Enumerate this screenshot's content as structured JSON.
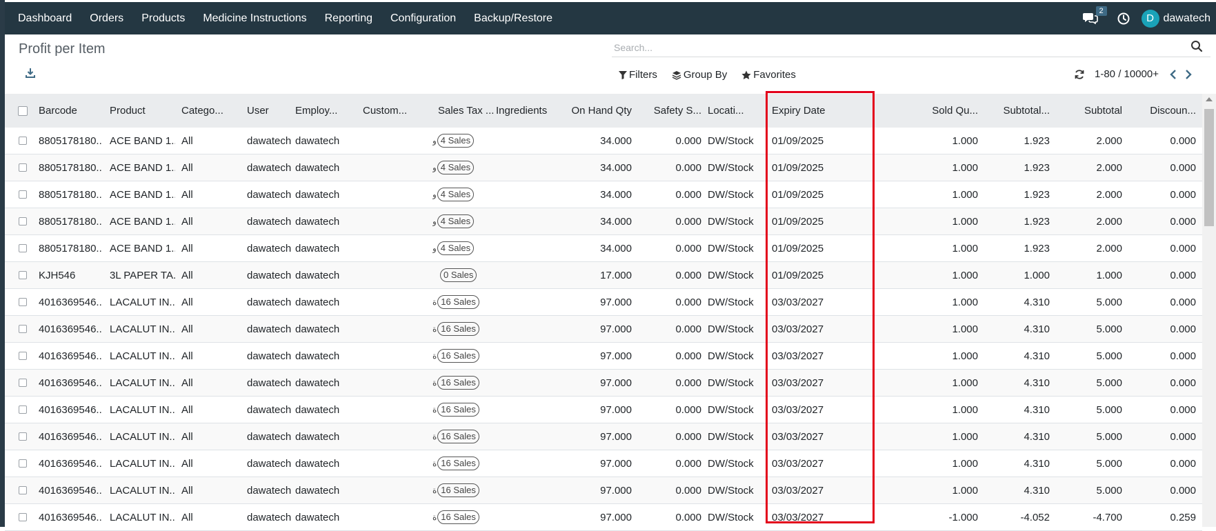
{
  "nav": {
    "items": [
      "Dashboard",
      "Orders",
      "Products",
      "Medicine Instructions",
      "Reporting",
      "Configuration",
      "Backup/Restore"
    ],
    "chat_count": "2",
    "avatar_letter": "D",
    "username": "dawatech"
  },
  "page": {
    "title": "Profit per Item",
    "search_placeholder": "Search...",
    "filters_label": "Filters",
    "groupby_label": "Group By",
    "favorites_label": "Favorites",
    "pager_value": "1-80 / 10000+"
  },
  "table": {
    "columns": [
      "Barcode",
      "Product",
      "Catego...",
      "User",
      "Employ...",
      "Custom...",
      "Sales Tax ...",
      "Ingredients",
      "On Hand Qty",
      "Safety S...",
      "Locati...",
      "Expiry Date",
      "Sold Qu...",
      "Subtotal...",
      "Subtotal",
      "Discoun..."
    ],
    "rows": [
      {
        "barcode": "8805178180...",
        "product": "ACE BAND 1...",
        "category": "All",
        "user": "dawatech",
        "employee": "dawatech",
        "customer": "",
        "tax_prefix": "و",
        "tax": "4 Sales",
        "ingredients": "",
        "onhand": "34.000",
        "safety": "0.000",
        "location": "DW/Stock",
        "expiry": "01/09/2025",
        "sold": "1.000",
        "subtotal_a": "1.923",
        "subtotal": "2.000",
        "discount": "0.000"
      },
      {
        "barcode": "8805178180...",
        "product": "ACE BAND 1...",
        "category": "All",
        "user": "dawatech",
        "employee": "dawatech",
        "customer": "",
        "tax_prefix": "و",
        "tax": "4 Sales",
        "ingredients": "",
        "onhand": "34.000",
        "safety": "0.000",
        "location": "DW/Stock",
        "expiry": "01/09/2025",
        "sold": "1.000",
        "subtotal_a": "1.923",
        "subtotal": "2.000",
        "discount": "0.000"
      },
      {
        "barcode": "8805178180...",
        "product": "ACE BAND 1...",
        "category": "All",
        "user": "dawatech",
        "employee": "dawatech",
        "customer": "",
        "tax_prefix": "و",
        "tax": "4 Sales",
        "ingredients": "",
        "onhand": "34.000",
        "safety": "0.000",
        "location": "DW/Stock",
        "expiry": "01/09/2025",
        "sold": "1.000",
        "subtotal_a": "1.923",
        "subtotal": "2.000",
        "discount": "0.000"
      },
      {
        "barcode": "8805178180...",
        "product": "ACE BAND 1...",
        "category": "All",
        "user": "dawatech",
        "employee": "dawatech",
        "customer": "",
        "tax_prefix": "و",
        "tax": "4 Sales",
        "ingredients": "",
        "onhand": "34.000",
        "safety": "0.000",
        "location": "DW/Stock",
        "expiry": "01/09/2025",
        "sold": "1.000",
        "subtotal_a": "1.923",
        "subtotal": "2.000",
        "discount": "0.000"
      },
      {
        "barcode": "8805178180...",
        "product": "ACE BAND 1...",
        "category": "All",
        "user": "dawatech",
        "employee": "dawatech",
        "customer": "",
        "tax_prefix": "و",
        "tax": "4 Sales",
        "ingredients": "",
        "onhand": "34.000",
        "safety": "0.000",
        "location": "DW/Stock",
        "expiry": "01/09/2025",
        "sold": "1.000",
        "subtotal_a": "1.923",
        "subtotal": "2.000",
        "discount": "0.000"
      },
      {
        "barcode": "KJH546",
        "product": "3L PAPER TA...",
        "category": "All",
        "user": "dawatech",
        "employee": "dawatech",
        "customer": "",
        "tax_prefix": "",
        "tax": "0 Sales",
        "ingredients": "",
        "onhand": "17.000",
        "safety": "0.000",
        "location": "DW/Stock",
        "expiry": "01/09/2025",
        "sold": "1.000",
        "subtotal_a": "1.000",
        "subtotal": "1.000",
        "discount": "0.000"
      },
      {
        "barcode": "4016369546...",
        "product": "LACALUT IN...",
        "category": "All",
        "user": "dawatech",
        "employee": "dawatech",
        "customer": "",
        "tax_prefix": "ة",
        "tax": "16 Sales",
        "ingredients": "",
        "onhand": "97.000",
        "safety": "0.000",
        "location": "DW/Stock",
        "expiry": "03/03/2027",
        "sold": "1.000",
        "subtotal_a": "4.310",
        "subtotal": "5.000",
        "discount": "0.000"
      },
      {
        "barcode": "4016369546...",
        "product": "LACALUT IN...",
        "category": "All",
        "user": "dawatech",
        "employee": "dawatech",
        "customer": "",
        "tax_prefix": "ة",
        "tax": "16 Sales",
        "ingredients": "",
        "onhand": "97.000",
        "safety": "0.000",
        "location": "DW/Stock",
        "expiry": "03/03/2027",
        "sold": "1.000",
        "subtotal_a": "4.310",
        "subtotal": "5.000",
        "discount": "0.000"
      },
      {
        "barcode": "4016369546...",
        "product": "LACALUT IN...",
        "category": "All",
        "user": "dawatech",
        "employee": "dawatech",
        "customer": "",
        "tax_prefix": "ة",
        "tax": "16 Sales",
        "ingredients": "",
        "onhand": "97.000",
        "safety": "0.000",
        "location": "DW/Stock",
        "expiry": "03/03/2027",
        "sold": "1.000",
        "subtotal_a": "4.310",
        "subtotal": "5.000",
        "discount": "0.000"
      },
      {
        "barcode": "4016369546...",
        "product": "LACALUT IN...",
        "category": "All",
        "user": "dawatech",
        "employee": "dawatech",
        "customer": "",
        "tax_prefix": "ة",
        "tax": "16 Sales",
        "ingredients": "",
        "onhand": "97.000",
        "safety": "0.000",
        "location": "DW/Stock",
        "expiry": "03/03/2027",
        "sold": "1.000",
        "subtotal_a": "4.310",
        "subtotal": "5.000",
        "discount": "0.000"
      },
      {
        "barcode": "4016369546...",
        "product": "LACALUT IN...",
        "category": "All",
        "user": "dawatech",
        "employee": "dawatech",
        "customer": "",
        "tax_prefix": "ة",
        "tax": "16 Sales",
        "ingredients": "",
        "onhand": "97.000",
        "safety": "0.000",
        "location": "DW/Stock",
        "expiry": "03/03/2027",
        "sold": "1.000",
        "subtotal_a": "4.310",
        "subtotal": "5.000",
        "discount": "0.000"
      },
      {
        "barcode": "4016369546...",
        "product": "LACALUT IN...",
        "category": "All",
        "user": "dawatech",
        "employee": "dawatech",
        "customer": "",
        "tax_prefix": "ة",
        "tax": "16 Sales",
        "ingredients": "",
        "onhand": "97.000",
        "safety": "0.000",
        "location": "DW/Stock",
        "expiry": "03/03/2027",
        "sold": "1.000",
        "subtotal_a": "4.310",
        "subtotal": "5.000",
        "discount": "0.000"
      },
      {
        "barcode": "4016369546...",
        "product": "LACALUT IN...",
        "category": "All",
        "user": "dawatech",
        "employee": "dawatech",
        "customer": "",
        "tax_prefix": "ة",
        "tax": "16 Sales",
        "ingredients": "",
        "onhand": "97.000",
        "safety": "0.000",
        "location": "DW/Stock",
        "expiry": "03/03/2027",
        "sold": "1.000",
        "subtotal_a": "4.310",
        "subtotal": "5.000",
        "discount": "0.000"
      },
      {
        "barcode": "4016369546...",
        "product": "LACALUT IN...",
        "category": "All",
        "user": "dawatech",
        "employee": "dawatech",
        "customer": "",
        "tax_prefix": "ة",
        "tax": "16 Sales",
        "ingredients": "",
        "onhand": "97.000",
        "safety": "0.000",
        "location": "DW/Stock",
        "expiry": "03/03/2027",
        "sold": "1.000",
        "subtotal_a": "4.310",
        "subtotal": "5.000",
        "discount": "0.000"
      },
      {
        "barcode": "4016369546...",
        "product": "LACALUT IN...",
        "category": "All",
        "user": "dawatech",
        "employee": "dawatech",
        "customer": "",
        "tax_prefix": "ة",
        "tax": "16 Sales",
        "ingredients": "",
        "onhand": "97.000",
        "safety": "0.000",
        "location": "DW/Stock",
        "expiry": "03/03/2027",
        "sold": "-1.000",
        "subtotal_a": "-4.052",
        "subtotal": "-4.700",
        "discount": "0.259"
      }
    ]
  },
  "colors": {
    "navbar": "#243742",
    "highlight": "#e3001b",
    "header_bg": "#eaecee"
  },
  "icons": [
    "chat-icon",
    "clock-icon",
    "search-icon",
    "download-icon",
    "filter-icon",
    "layers-icon",
    "star-icon",
    "refresh-icon",
    "chevron-left-icon",
    "chevron-right-icon"
  ]
}
